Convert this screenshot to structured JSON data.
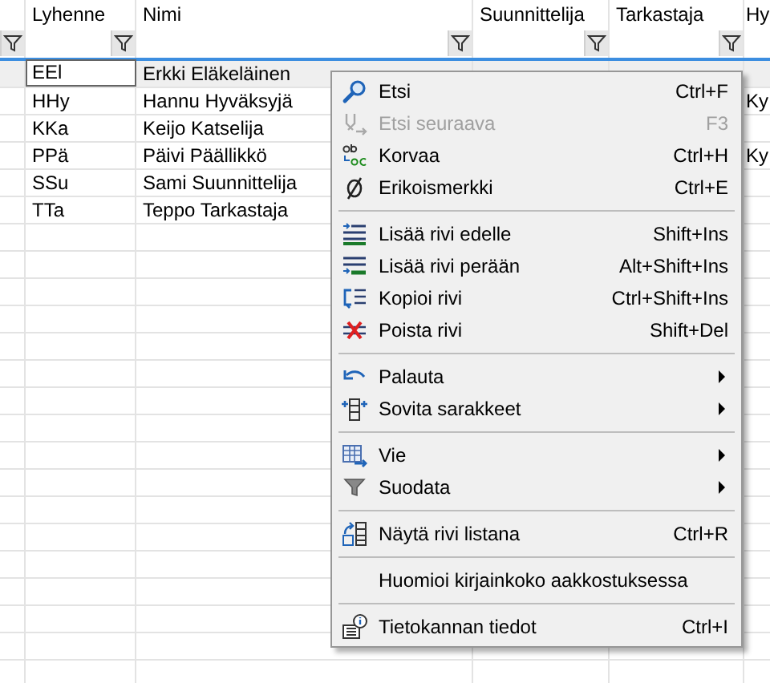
{
  "table": {
    "columns": [
      {
        "filter": true
      },
      {
        "label": "Lyhenne",
        "filter": true
      },
      {
        "label": "Nimi",
        "filter": true
      },
      {
        "label": "Suunnittelija",
        "filter": true
      },
      {
        "label": "Tarkastaja",
        "filter": true
      },
      {
        "label": "Hy"
      }
    ],
    "rows": [
      {
        "selected": true,
        "editing": true,
        "cells": [
          "",
          "EEl",
          "Erkki Eläkeläinen",
          "",
          "",
          ""
        ]
      },
      {
        "selected": false,
        "cells": [
          "",
          "HHy",
          "Hannu Hyväksyjä",
          "",
          "",
          "Ky"
        ]
      },
      {
        "selected": false,
        "cells": [
          "",
          "KKa",
          "Keijo Katselija",
          "",
          "",
          ""
        ]
      },
      {
        "selected": false,
        "cells": [
          "",
          "PPä",
          "Päivi Päällikkö",
          "",
          "",
          "Ky"
        ]
      },
      {
        "selected": false,
        "cells": [
          "",
          "SSu",
          "Sami Suunnittelija",
          "",
          "",
          ""
        ]
      },
      {
        "selected": false,
        "cells": [
          "",
          "TTa",
          "Teppo Tarkastaja",
          "",
          "",
          ""
        ]
      }
    ]
  },
  "context_menu": {
    "items": [
      {
        "kind": "item",
        "label": "Etsi",
        "shortcut": "Ctrl+F",
        "disabled": false,
        "submenu": false
      },
      {
        "kind": "item",
        "label": "Etsi seuraava",
        "shortcut": "F3",
        "disabled": true,
        "submenu": false
      },
      {
        "kind": "item",
        "label": "Korvaa",
        "shortcut": "Ctrl+H",
        "disabled": false,
        "submenu": false
      },
      {
        "kind": "item",
        "label": "Erikoismerkki",
        "shortcut": "Ctrl+E",
        "disabled": false,
        "submenu": false
      },
      {
        "kind": "separator"
      },
      {
        "kind": "item",
        "label": "Lisää rivi edelle",
        "shortcut": "Shift+Ins",
        "disabled": false,
        "submenu": false
      },
      {
        "kind": "item",
        "label": "Lisää rivi perään",
        "shortcut": "Alt+Shift+Ins",
        "disabled": false,
        "submenu": false
      },
      {
        "kind": "item",
        "label": "Kopioi rivi",
        "shortcut": "Ctrl+Shift+Ins",
        "disabled": false,
        "submenu": false
      },
      {
        "kind": "item",
        "label": "Poista rivi",
        "shortcut": "Shift+Del",
        "disabled": false,
        "submenu": false
      },
      {
        "kind": "separator"
      },
      {
        "kind": "item",
        "label": "Palauta",
        "disabled": false,
        "submenu": true
      },
      {
        "kind": "item",
        "label": "Sovita sarakkeet",
        "disabled": false,
        "submenu": true
      },
      {
        "kind": "separator"
      },
      {
        "kind": "item",
        "label": "Vie",
        "disabled": false,
        "submenu": true
      },
      {
        "kind": "item",
        "label": "Suodata",
        "disabled": false,
        "submenu": true
      },
      {
        "kind": "separator"
      },
      {
        "kind": "item",
        "label": "Näytä rivi listana",
        "shortcut": "Ctrl+R",
        "disabled": false,
        "submenu": false
      },
      {
        "kind": "separator"
      },
      {
        "kind": "item",
        "label": "Huomioi kirjainkoko aakkostuksessa",
        "disabled": false,
        "submenu": false
      },
      {
        "kind": "separator"
      },
      {
        "kind": "item",
        "label": "Tietokannan tiedot",
        "shortcut": "Ctrl+I",
        "disabled": false,
        "submenu": false
      }
    ]
  }
}
